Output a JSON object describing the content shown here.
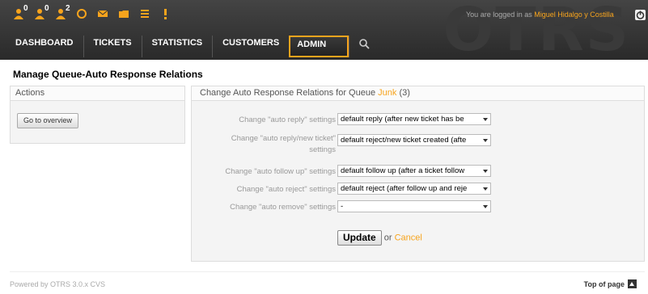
{
  "header": {
    "watermark": "OTRS",
    "login_prefix": "You are logged in as",
    "user_name": "Miguel Hidalgo y Costilla",
    "toolbar": [
      {
        "icon": "locked-tickets-icon",
        "badge": "0"
      },
      {
        "icon": "watched-tickets-icon",
        "badge": "0"
      },
      {
        "icon": "responsible-tickets-icon",
        "badge": "2"
      },
      {
        "icon": "refresh-icon",
        "badge": ""
      },
      {
        "icon": "mail-icon",
        "badge": ""
      },
      {
        "icon": "folder-icon",
        "badge": ""
      },
      {
        "icon": "list-icon",
        "badge": ""
      },
      {
        "icon": "exclamation-icon",
        "badge": ""
      }
    ],
    "nav": [
      "DASHBOARD",
      "TICKETS",
      "STATISTICS",
      "CUSTOMERS",
      "ADMIN"
    ],
    "accent": "#f7a41d"
  },
  "page": {
    "title": "Manage Queue-Auto Response Relations"
  },
  "actions": {
    "heading": "Actions",
    "go_overview": "Go to overview"
  },
  "main": {
    "heading_prefix": "Change Auto Response Relations for Queue",
    "queue": "Junk",
    "count": "(3)",
    "rows": [
      {
        "label": "Change \"auto reply\" settings",
        "value": "default reply (after new ticket has be"
      },
      {
        "label1": "Change \"auto reply/new ticket\"",
        "label2": "settings",
        "value": "default reject/new ticket created (afte"
      },
      {
        "label": "Change \"auto follow up\" settings",
        "value": "default follow up (after a ticket follow"
      },
      {
        "label": "Change \"auto reject\" settings",
        "value": "default reject (after follow up and reje"
      },
      {
        "label": "Change \"auto remove\" settings",
        "value": "-"
      }
    ],
    "update": "Update",
    "or": "or",
    "cancel": "Cancel"
  },
  "footer": {
    "powered": "Powered by OTRS 3.0.x CVS",
    "top_of_page": "Top of page"
  }
}
